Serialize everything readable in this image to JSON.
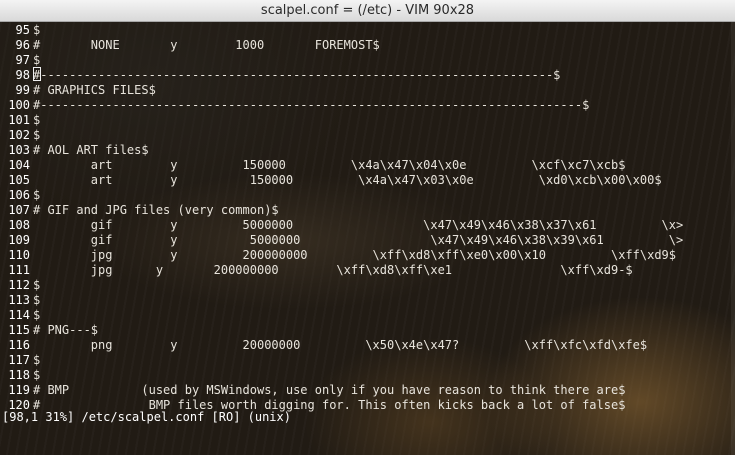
{
  "window": {
    "title": "scalpel.conf = (/etc) - VIM 90x28"
  },
  "editor": {
    "lines": [
      {
        "num": "95",
        "text": "$"
      },
      {
        "num": "96",
        "text": "#       NONE       y        1000       FOREMOST$"
      },
      {
        "num": "97",
        "text": "$"
      },
      {
        "num": "98",
        "text": "#-----------------------------------------------------------------------$"
      },
      {
        "num": "99",
        "text": "# GRAPHICS FILES$"
      },
      {
        "num": "100",
        "text": "#---------------------------------------------------------------------------$"
      },
      {
        "num": "101",
        "text": "$"
      },
      {
        "num": "102",
        "text": "$"
      },
      {
        "num": "103",
        "text": "# AOL ART files$"
      },
      {
        "num": "104",
        "text": "        art        y         150000         \\x4a\\x47\\x04\\x0e         \\xcf\\xc7\\xcb$"
      },
      {
        "num": "105",
        "text": "        art        y          150000         \\x4a\\x47\\x03\\x0e         \\xd0\\xcb\\x00\\x00$"
      },
      {
        "num": "106",
        "text": "$"
      },
      {
        "num": "107",
        "text": "# GIF and JPG files (very common)$"
      },
      {
        "num": "108",
        "text": "        gif        y         5000000                  \\x47\\x49\\x46\\x38\\x37\\x61         \\x>"
      },
      {
        "num": "109",
        "text": "        gif        y          5000000                  \\x47\\x49\\x46\\x38\\x39\\x61         \\>"
      },
      {
        "num": "110",
        "text": "        jpg        y         200000000         \\xff\\xd8\\xff\\xe0\\x00\\x10         \\xff\\xd9$"
      },
      {
        "num": "111",
        "text": "        jpg      y       200000000        \\xff\\xd8\\xff\\xe1               \\xff\\xd9-$"
      },
      {
        "num": "112",
        "text": "$"
      },
      {
        "num": "113",
        "text": "$"
      },
      {
        "num": "114",
        "text": "$"
      },
      {
        "num": "115",
        "text": "# PNG---$"
      },
      {
        "num": "116",
        "text": "        png        y         20000000         \\x50\\x4e\\x47?         \\xff\\xfc\\xfd\\xfe$"
      },
      {
        "num": "117",
        "text": "$"
      },
      {
        "num": "118",
        "text": "$"
      },
      {
        "num": "119",
        "text": "# BMP          (used by MSWindows, use only if you have reason to think there are$"
      },
      {
        "num": "120",
        "text": "#               BMP files worth digging for. This often kicks back a lot of false$"
      }
    ],
    "status": "[98,1 31%] /etc/scalpel.conf [RO] (unix)"
  }
}
